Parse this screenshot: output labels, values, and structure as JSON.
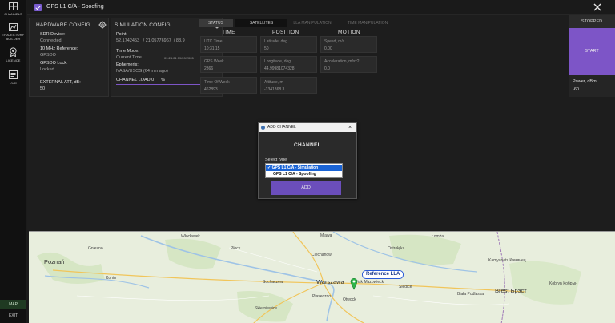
{
  "rail": {
    "items": [
      {
        "label": "CHANNELS",
        "icon": "grid-icon"
      },
      {
        "label": "TRAJECTORY BUILDER",
        "icon": "map-icon"
      },
      {
        "label": "LICENCE",
        "icon": "badge-icon"
      },
      {
        "label": "LOG",
        "icon": "log-icon"
      }
    ],
    "map_label": "MAP",
    "exit_label": "EXIT"
  },
  "window": {
    "title": "GPS L1 C/A - Spoofing"
  },
  "hardware": {
    "title": "HARDWARE CONFIG",
    "sdr_label": "SDR Device:",
    "sdr_value": "Connected",
    "ref_label": "10 MHz Reference:",
    "ref_value": "GPSDO",
    "lock_label": "GPSDO Lock:",
    "lock_value": "Locked",
    "att_label": "EXTERNAL ATT, dB:",
    "att_value": "50"
  },
  "simulation": {
    "title": "SIMULATION CONFIG",
    "point_label": "Point:",
    "point_value": "52.1742453   / 21.05776967  / 88.9",
    "time_mode_label": "Time Mode:",
    "time_mode_value": "Current Time",
    "time_mode_stamp": "09:24:01  09/09/2005",
    "ephemeris_label": "Ephemeris:",
    "ephemeris_value": "NASA/USCG (64 min ago)",
    "channel_load_label": "CHANNEL LOAD:0",
    "channel_load_unit": "%"
  },
  "tabs": [
    "STATUS",
    "SATELLITES",
    "LLA MANIPULATION",
    "TIME MANIPULATION"
  ],
  "columns": [
    "TIME",
    "POSITION",
    "MOTION"
  ],
  "fields": {
    "utc_label": "UTC Time",
    "utc_value": "10:31:15",
    "lat_label": "Latitude, deg",
    "lat_value": "50",
    "speed_label": "Speed, m/s",
    "speed_value": "0.00",
    "week_label": "GPS Week",
    "week_value": "2366",
    "lon_label": "Longitude, deg",
    "lon_value": "44.99981074328",
    "accel_label": "Acceleration, m/s^2",
    "accel_value": "0.0",
    "tow_label": "Time Of Week",
    "tow_value": "462893",
    "alt_label": "Altitude, m",
    "alt_value": "-1341868.3"
  },
  "status": {
    "state": "STOPPED",
    "start_label": "START",
    "power_label": "Power, dBm",
    "power_value": "-60"
  },
  "dialog": {
    "title": "ADD CHANNEL",
    "heading": "CHANNEL",
    "select_label": "Select type",
    "options": [
      "✓ GPS L1 C/A - Simulation",
      "GPS L1 C/A - Spoofing"
    ],
    "add_label": "ADD"
  },
  "map": {
    "reference_label": "Reference LLA",
    "cities": [
      {
        "name": "Poznań",
        "big": true
      },
      {
        "name": "Warszawa",
        "big": true
      },
      {
        "name": "Brest Брэст",
        "big": true
      },
      {
        "name": "Włocławek",
        "big": false
      },
      {
        "name": "Płock",
        "big": false
      },
      {
        "name": "Mława",
        "big": false
      },
      {
        "name": "Ciechanów",
        "big": false
      },
      {
        "name": "Ostrołęka",
        "big": false
      },
      {
        "name": "Łomża",
        "big": false
      },
      {
        "name": "Siedlce",
        "big": false
      },
      {
        "name": "Skierniewice",
        "big": false
      },
      {
        "name": "Konin",
        "big": false
      },
      {
        "name": "Sochaczew",
        "big": false
      },
      {
        "name": "Mińsk Mazowiecki",
        "big": false
      },
      {
        "name": "Biała Podlaska",
        "big": false
      },
      {
        "name": "Gniezno",
        "big": false
      },
      {
        "name": "Piaseczno",
        "big": false
      },
      {
        "name": "Otwock",
        "big": false
      },
      {
        "name": "Kobryn Кобрын",
        "big": false
      },
      {
        "name": "Kamyanets Камянец",
        "big": false
      }
    ]
  }
}
